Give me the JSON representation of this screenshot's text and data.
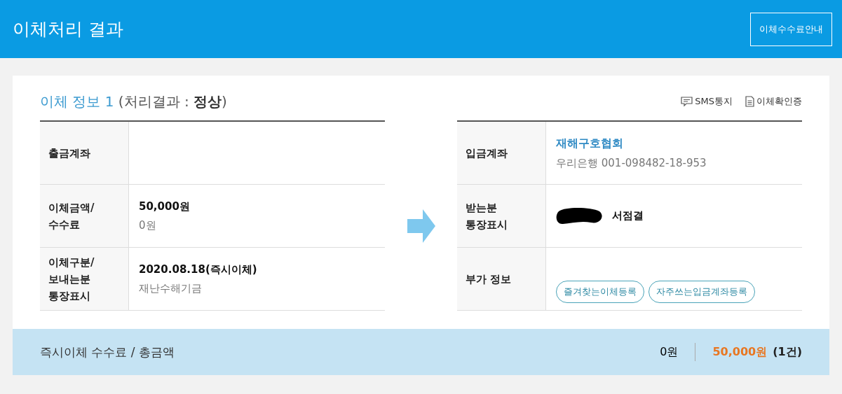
{
  "header": {
    "title": "이체처리 결과",
    "fee_guide_button": "이체수수료안내"
  },
  "section": {
    "title": "이체 정보 1",
    "result_prefix": "(처리결과 : ",
    "result": "정상",
    "result_suffix": ")"
  },
  "actions": [
    {
      "label": "SMS통지",
      "kind": "sms"
    },
    {
      "label": "이체확인증",
      "kind": "doc"
    }
  ],
  "sender_rows": [
    {
      "label": "출금계좌",
      "lines": []
    },
    {
      "label": "이체금액/\n수수료",
      "lines": [
        {
          "text": "50,000원",
          "kind": "strong"
        },
        {
          "text": "0원",
          "kind": "sub"
        }
      ]
    },
    {
      "label": "이체구분/\n보내는분\n통장표시",
      "lines": [
        {
          "text": "2020.08.18(즉시이체)",
          "kind": "strong"
        },
        {
          "text": "재난수해기금",
          "kind": "sub"
        }
      ]
    }
  ],
  "receiver_rows": [
    {
      "label": "입금계좌",
      "kind": "account",
      "lines": [
        {
          "text": "재해구호협회",
          "kind": "link"
        },
        {
          "text": "우리은행 001-098482-18-953",
          "kind": "sub"
        }
      ]
    },
    {
      "label": "받는분\n통장표시",
      "kind": "name",
      "lines": [
        {
          "text": "서점결",
          "kind": "strong"
        }
      ]
    },
    {
      "label": "부가 정보",
      "kind": "buttons",
      "buttons": [
        "즐겨찾는이체등록",
        "자주쓰는입금계좌등록"
      ]
    }
  ],
  "summary": {
    "label": "즉시이체 수수료 / 총금액",
    "fee": "0원",
    "total": "50,000원",
    "count": "(1건)"
  }
}
